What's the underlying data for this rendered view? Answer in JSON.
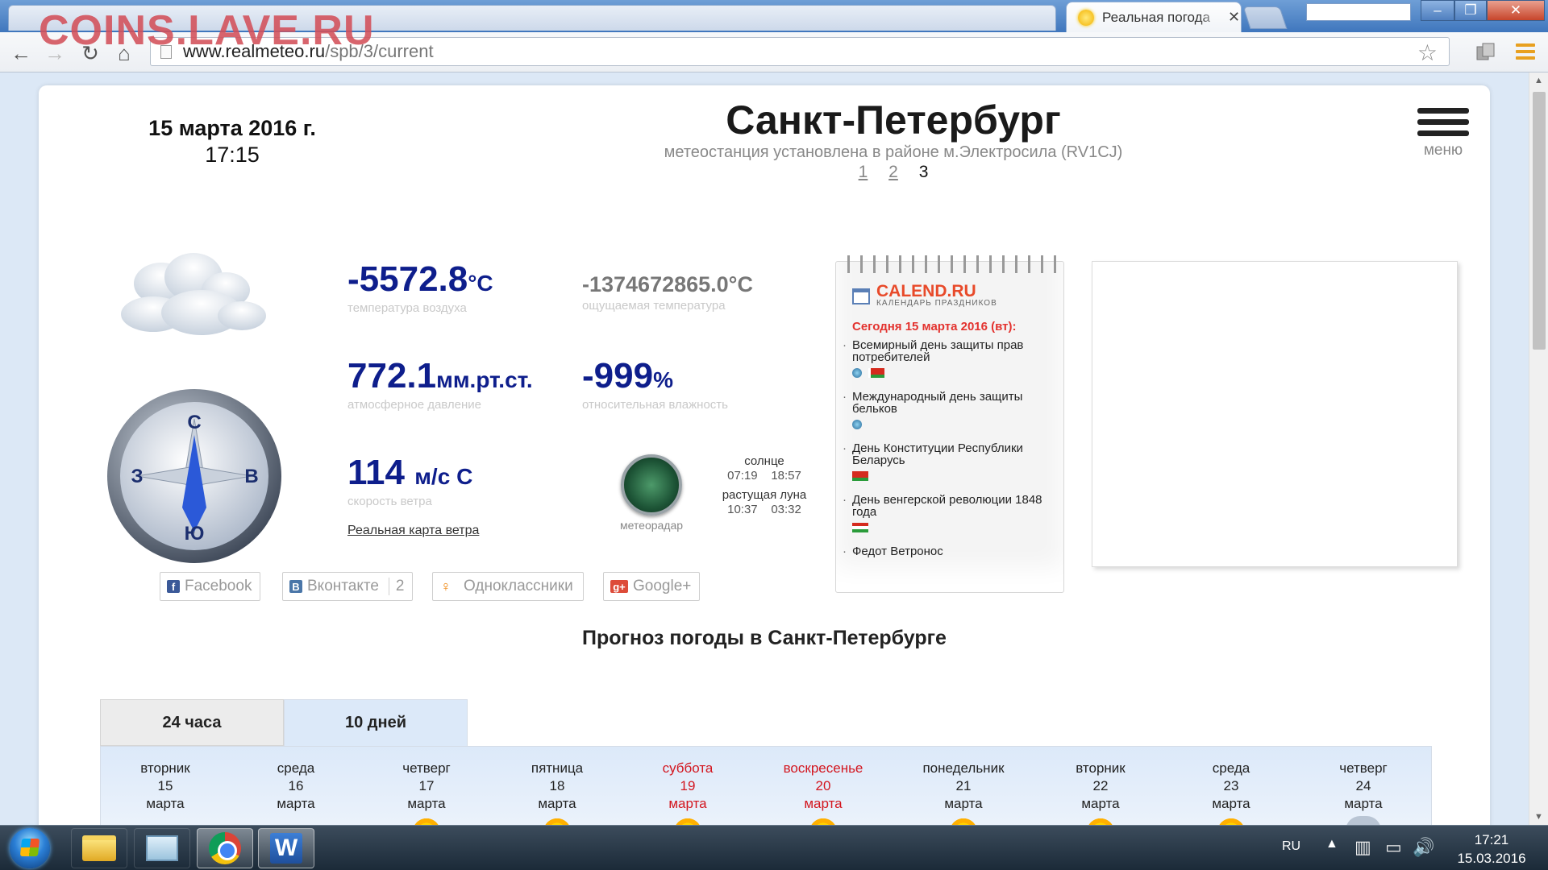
{
  "watermark": "COINS.LAVE.RU",
  "browser": {
    "tab_title": "Реальная погода",
    "url_host": "www.realmeteo.ru",
    "url_path": "/spb/3/current"
  },
  "header": {
    "date": "15 марта 2016 г.",
    "time": "17:15",
    "city": "Санкт-Петербург",
    "station_note": "метеостанция установлена в районе м.Электросила (RV1CJ)",
    "station_pages": [
      "1",
      "2"
    ],
    "station_current": "3",
    "menu_label": "меню"
  },
  "weather": {
    "temperature": {
      "value": "-5572.8",
      "unit": "°C",
      "label": "температура воздуха"
    },
    "feels_like": {
      "value": "-1374672865.0°C",
      "label": "ощущаемая температура"
    },
    "pressure": {
      "value": "772.1",
      "unit": "мм.рт.ст.",
      "label": "атмосферное давление"
    },
    "humidity": {
      "value": "-999",
      "unit": "%",
      "label": "относительная влажность"
    },
    "wind": {
      "value": "114",
      "unit": "м/с С",
      "label": "скорость ветра"
    },
    "wind_map_link": "Реальная карта ветра",
    "compass": {
      "n": "С",
      "e": "В",
      "s": "Ю",
      "w": "З"
    },
    "radar_label": "метеорадар",
    "sun_label": "солнце",
    "sunrise": "07:19",
    "sunset": "18:57",
    "moon_label": "растущая луна",
    "moonrise": "10:37",
    "moonset": "03:32"
  },
  "calendar": {
    "brand": "CALEND.RU",
    "subtitle": "КАЛЕНДАРЬ ПРАЗДНИКОВ",
    "today": "Сегодня 15 марта 2016 (вт):",
    "items": [
      "Всемирный день защиты прав потребителей",
      "Международный день защиты бельков",
      "День Конституции Республики Беларусь",
      "День венгерской революции 1848 года",
      "Федот Ветронос"
    ]
  },
  "share": {
    "facebook": "Facebook",
    "vk": "Вконтакте",
    "vk_count": "2",
    "ok": "Одноклассники",
    "gplus": "Google+"
  },
  "forecast": {
    "title": "Прогноз погоды в Санкт-Петербурге",
    "tab_24h": "24 часа",
    "tab_10d": "10 дней",
    "days": [
      {
        "weekday": "вторник",
        "num": "15",
        "month": "марта",
        "weekend": false,
        "icon": "none"
      },
      {
        "weekday": "среда",
        "num": "16",
        "month": "марта",
        "weekend": false,
        "icon": "none"
      },
      {
        "weekday": "четверг",
        "num": "17",
        "month": "марта",
        "weekend": false,
        "icon": "sun"
      },
      {
        "weekday": "пятница",
        "num": "18",
        "month": "марта",
        "weekend": false,
        "icon": "sun"
      },
      {
        "weekday": "суббота",
        "num": "19",
        "month": "марта",
        "weekend": true,
        "icon": "sun"
      },
      {
        "weekday": "воскресенье",
        "num": "20",
        "month": "марта",
        "weekend": true,
        "icon": "sun"
      },
      {
        "weekday": "понедельник",
        "num": "21",
        "month": "марта",
        "weekend": false,
        "icon": "sun"
      },
      {
        "weekday": "вторник",
        "num": "22",
        "month": "марта",
        "weekend": false,
        "icon": "sun"
      },
      {
        "weekday": "среда",
        "num": "23",
        "month": "марта",
        "weekend": false,
        "icon": "sun"
      },
      {
        "weekday": "четверг",
        "num": "24",
        "month": "марта",
        "weekend": false,
        "icon": "cloud"
      }
    ]
  },
  "taskbar": {
    "lang": "RU",
    "clock_time": "17:21",
    "clock_date": "15.03.2016"
  },
  "colors": {
    "accent_value": "#0e1e8c",
    "weekend": "#d3161f",
    "calendar_red": "#e3322e"
  }
}
